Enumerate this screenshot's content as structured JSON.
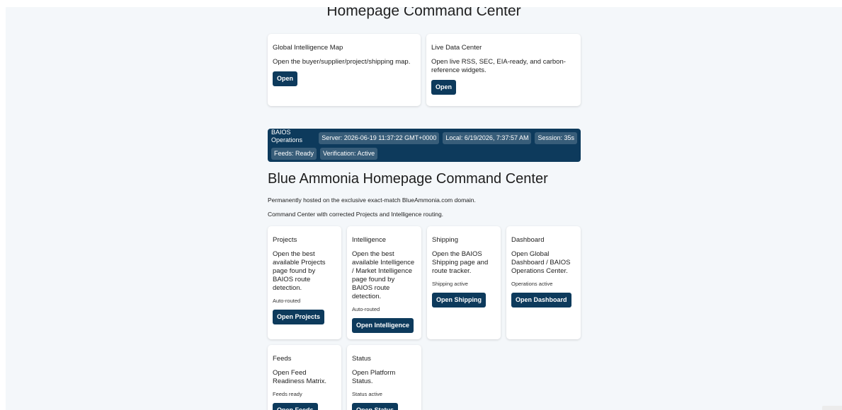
{
  "page": {
    "top_title": "Homepage Command Center",
    "main_heading": "Blue Ammonia Homepage Command Center",
    "subtitle_1": "Permanently hosted on the exclusive exact-match BlueAmmonia.com domain.",
    "subtitle_2": "Command Center with corrected Projects and Intelligence routing."
  },
  "top_cards": [
    {
      "title": "Global Intelligence Map",
      "description": "Open the buyer/supplier/project/shipping map.",
      "button": "Open"
    },
    {
      "title": "Live Data Center",
      "description": "Open live RSS, SEC, EIA-ready, and carbon-reference widgets.",
      "button": "Open"
    }
  ],
  "ops": {
    "label": "BAIOS Operations",
    "server": "Server: 2026-06-19 11:37:22 GMT+0000",
    "local": "Local: 6/19/2026, 7:37:57 AM",
    "session": "Session: 35s",
    "feeds": "Feeds: Ready",
    "verification": "Verification: Active"
  },
  "modules": [
    {
      "title": "Projects",
      "description": "Open the best available Projects page found by BAIOS route detection.",
      "note": "Auto-routed",
      "button": "Open Projects"
    },
    {
      "title": "Intelligence",
      "description": "Open the best available Intelligence / Market Intelligence page found by BAIOS route detection.",
      "note": "Auto-routed",
      "button": "Open Intelligence"
    },
    {
      "title": "Shipping",
      "description": "Open the BAIOS Shipping page and route tracker.",
      "note": "Shipping active",
      "button": "Open Shipping"
    },
    {
      "title": "Dashboard",
      "description": "Open Global Dashboard / BAIOS Operations Center.",
      "note": "Operations active",
      "button": "Open Dashboard"
    },
    {
      "title": "Feeds",
      "description": "Open Feed Readiness Matrix.",
      "note": "Feeds ready",
      "button": "Open Feeds"
    },
    {
      "title": "Status",
      "description": "Open Platform Status.",
      "note": "Status active",
      "button": "Open Status"
    }
  ],
  "colors": {
    "accent": "#0d3a5c",
    "page_background": "#f4f7fa",
    "card_background": "#ffffff"
  }
}
